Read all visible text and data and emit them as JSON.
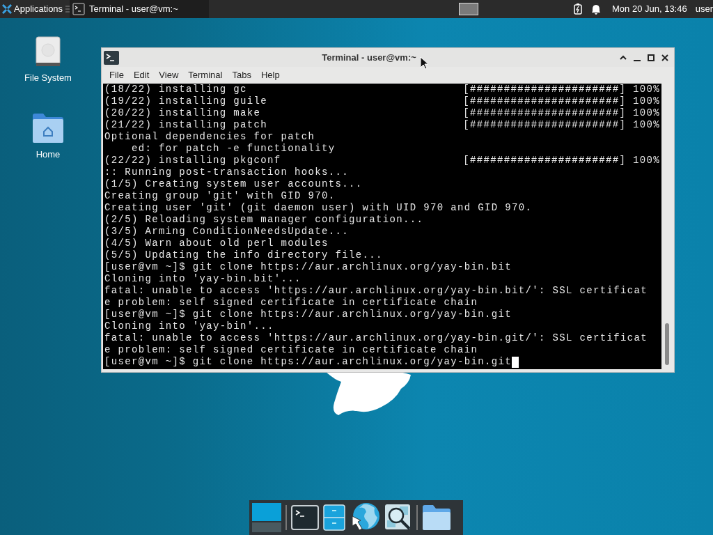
{
  "top_panel": {
    "applications_label": "Applications",
    "task": {
      "title": "Terminal - user@vm:~",
      "selected": true
    },
    "clock": "Mon 20 Jun, 13:46",
    "user": "user"
  },
  "desktop_icons": [
    {
      "label": "File System",
      "kind": "drive"
    },
    {
      "label": "Home",
      "kind": "home"
    }
  ],
  "window": {
    "title": "Terminal - user@vm:~",
    "menu": [
      "File",
      "Edit",
      "View",
      "Terminal",
      "Tabs",
      "Help"
    ],
    "lines": [
      {
        "text": "(18/22) installing gc",
        "progress": "[######################] 100%"
      },
      {
        "text": "(19/22) installing guile",
        "progress": "[######################] 100%"
      },
      {
        "text": "(20/22) installing make",
        "progress": "[######################] 100%"
      },
      {
        "text": "(21/22) installing patch",
        "progress": "[######################] 100%"
      },
      {
        "text": "Optional dependencies for patch"
      },
      {
        "text": "    ed: for patch -e functionality"
      },
      {
        "text": "(22/22) installing pkgconf",
        "progress": "[######################] 100%"
      },
      {
        "text": ":: Running post-transaction hooks..."
      },
      {
        "text": "(1/5) Creating system user accounts..."
      },
      {
        "text": "Creating group 'git' with GID 970."
      },
      {
        "text": "Creating user 'git' (git daemon user) with UID 970 and GID 970."
      },
      {
        "text": "(2/5) Reloading system manager configuration..."
      },
      {
        "text": "(3/5) Arming ConditionNeedsUpdate..."
      },
      {
        "text": "(4/5) Warn about old perl modules"
      },
      {
        "text": "(5/5) Updating the info directory file..."
      },
      {
        "text": "[user@vm ~]$ git clone https://aur.archlinux.org/yay-bin.bit"
      },
      {
        "text": "Cloning into 'yay-bin.bit'..."
      },
      {
        "text": "fatal: unable to access 'https://aur.archlinux.org/yay-bin.bit/': SSL certificat"
      },
      {
        "text": "e problem: self signed certificate in certificate chain"
      },
      {
        "text": "[user@vm ~]$ git clone https://aur.archlinux.org/yay-bin.git"
      },
      {
        "text": "Cloning into 'yay-bin'..."
      },
      {
        "text": "fatal: unable to access 'https://aur.archlinux.org/yay-bin.git/': SSL certificat"
      },
      {
        "text": "e problem: self signed certificate in certificate chain"
      },
      {
        "text": "[user@vm ~]$ git clone https://aur.archlinux.org/yay-bin.git"
      }
    ],
    "cursor_visible": true
  },
  "dock": [
    {
      "kind": "desktop"
    },
    {
      "kind": "terminal"
    },
    {
      "kind": "files"
    },
    {
      "kind": "browser"
    },
    {
      "kind": "search"
    },
    {
      "kind": "folder"
    }
  ]
}
